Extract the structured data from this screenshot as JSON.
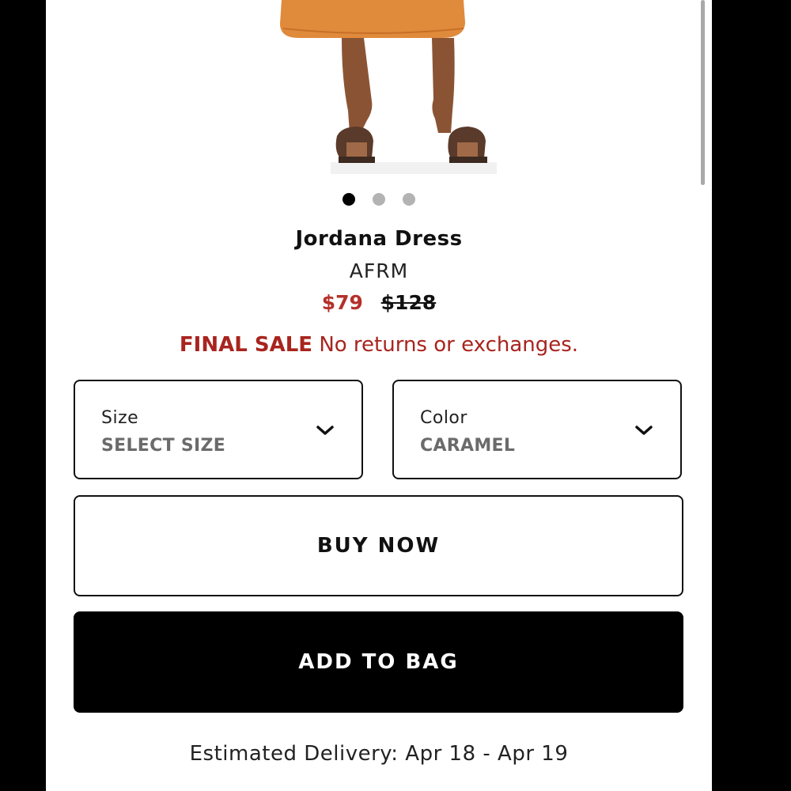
{
  "product": {
    "title": "Jordana Dress",
    "brand": "AFRM",
    "price_sale": "$79",
    "price_original": "$128",
    "dress_color": "#e08a3c"
  },
  "carousel": {
    "count": 3,
    "active_index": 0
  },
  "final_sale": {
    "label": "FINAL SALE",
    "note": "No returns or exchanges.",
    "color": "#a8241e"
  },
  "size_select": {
    "label": "Size",
    "value": "SELECT SIZE",
    "icon": "chevron-down-icon"
  },
  "color_select": {
    "label": "Color",
    "value": "CARAMEL",
    "icon": "chevron-down-icon"
  },
  "buttons": {
    "buy_now": "BUY NOW",
    "add_to_bag": "ADD TO BAG"
  },
  "delivery": {
    "text": "Estimated Delivery: Apr 18 - Apr 19"
  }
}
